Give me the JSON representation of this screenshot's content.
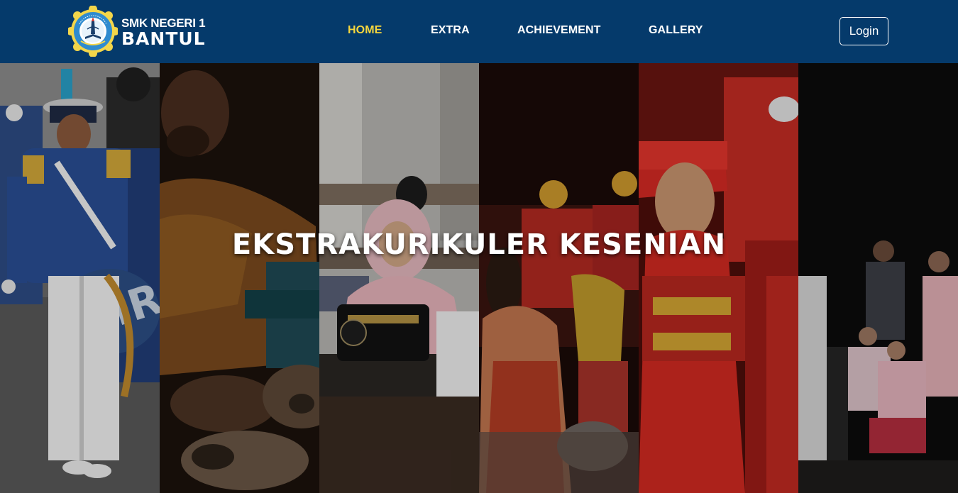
{
  "header": {
    "logo": {
      "icon": "school-emblem-icon",
      "ring_text": "SMK NEGERI 1 BANTUL",
      "colors": {
        "outer": "#f3d64a",
        "ring": "#2f8bcf",
        "inner": "#ffffff"
      }
    },
    "brand_line1": "SMK NEGERI 1",
    "brand_line2": "BANTUL",
    "nav": [
      {
        "label": "HOME",
        "active": true
      },
      {
        "label": "EXTRA",
        "active": false
      },
      {
        "label": "ACHIEVEMENT",
        "active": false
      },
      {
        "label": "GALLERY",
        "active": false
      }
    ],
    "login_label": "Login",
    "colors": {
      "background": "#053a6b",
      "active_link": "#f5d63d",
      "link": "#ffffff"
    }
  },
  "hero": {
    "title": "EKSTRAKURIKULER KESENIAN",
    "panels": [
      {
        "name": "marching-band-photo"
      },
      {
        "name": "gamelan-photo"
      },
      {
        "name": "sewing-photo"
      },
      {
        "name": "traditional-dance-photo"
      },
      {
        "name": "dancer-closeup-photo"
      },
      {
        "name": "theater-photo"
      }
    ]
  }
}
